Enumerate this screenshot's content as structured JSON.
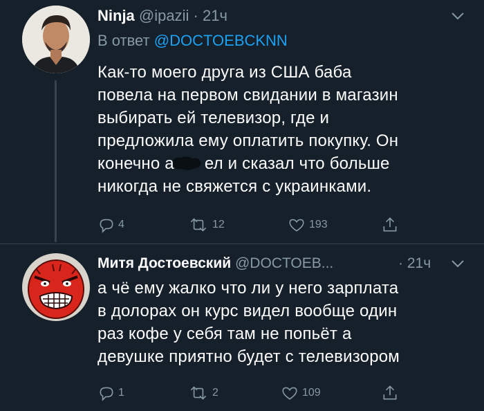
{
  "tweets": [
    {
      "display_name": "Ninja",
      "handle": "@ipazii",
      "separator": "·",
      "time": "21ч",
      "reply_prefix": "В ответ",
      "reply_to": "@DOCTOEBCKNN",
      "lines": [
        "Как-то моего друга из США баба",
        "повела на первом свидании в магазин",
        "выбирать ей телевизор, где и",
        "предложила ему оплатить покупку. Он",
        "конечно а",
        "ел и сказал что больше",
        "никогда не свяжется с украинками."
      ],
      "replies": "4",
      "retweets": "12",
      "likes": "193"
    },
    {
      "display_name": "Митя Достоевский",
      "handle": "@DOCTOEB...",
      "separator": "·",
      "time": "21ч",
      "lines": [
        "а чё ему жалко что ли у него зарплата",
        "в долорах он курс видел вообще один",
        "раз кофе у себя там не попьёт а",
        "девушке приятно будет с телевизором"
      ],
      "replies": "1",
      "retweets": "2",
      "likes": "109"
    }
  ],
  "colors": {
    "background": "#15202b",
    "text": "#ffffff",
    "secondary": "#8899a6",
    "link": "#1da1f2",
    "thread_line": "#38444d"
  },
  "icons": [
    "reply-icon",
    "retweet-icon",
    "like-icon",
    "share-icon",
    "chevron-down-icon"
  ]
}
